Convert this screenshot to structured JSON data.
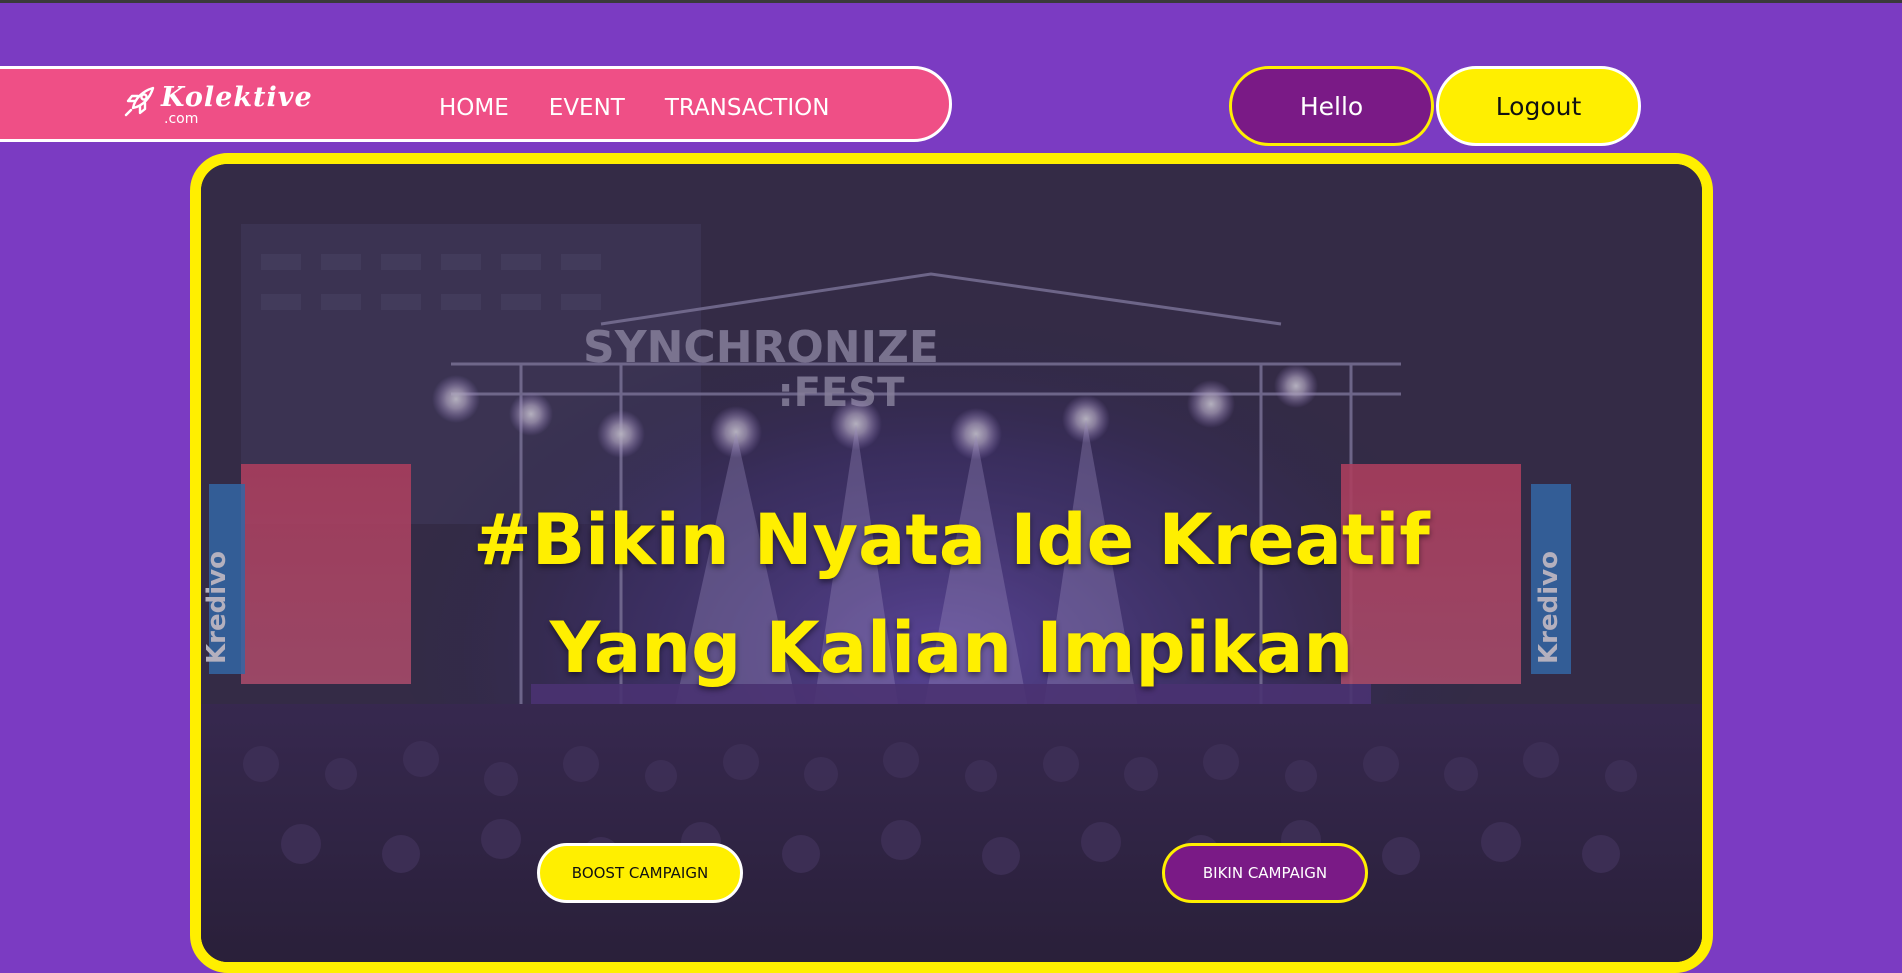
{
  "brand": {
    "name": "Kolektive",
    "domain": ".com"
  },
  "nav": {
    "items": [
      {
        "label": "HOME"
      },
      {
        "label": "EVENT"
      },
      {
        "label": "TRANSACTION"
      }
    ]
  },
  "user": {
    "hello_label": "Hello",
    "logout_label": "Logout"
  },
  "hero": {
    "headline_line1": "#Bikin Nyata Ide Kreatif",
    "headline_line2": "Yang Kalian Impikan",
    "stage_sign_line1": "SYNCHRONIZE",
    "stage_sign_line2": ":FEST",
    "screen_text_left": "Kredivo",
    "screen_text_right": "Kredivo",
    "boost_label": "BOOST CAMPAIGN",
    "bikin_label": "BIKIN CAMPAIGN"
  },
  "colors": {
    "page_background": "#7b3bc2",
    "navbar": "#ef4f86",
    "accent_yellow": "#ffef00",
    "accent_purple": "#7a1a86"
  },
  "icons": {
    "logo": "rocket-icon"
  }
}
